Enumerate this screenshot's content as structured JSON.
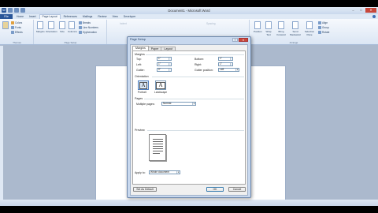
{
  "window": {
    "title": "Document1 - Microsoft Word"
  },
  "tabs": {
    "file": "File",
    "items": [
      "Home",
      "Insert",
      "Page Layout",
      "References",
      "Mailings",
      "Review",
      "View",
      "Developer"
    ],
    "active_index": 2
  },
  "ribbon": {
    "themes": {
      "colors": "Colors",
      "fonts": "Fonts",
      "effects": "Effects",
      "group": "Themes"
    },
    "page_setup": {
      "margins": "Margins",
      "orientation": "Orientation",
      "size": "Size",
      "columns": "Columns",
      "breaks": "Breaks",
      "line_numbers": "Line Numbers",
      "hyphenation": "Hyphenation",
      "group": "Page Setup"
    },
    "paragraph": {
      "indent": "Indent",
      "spacing": "Spacing",
      "group": "Paragraph"
    },
    "arrange": {
      "position": "Position",
      "wrap_text": "Wrap Text",
      "bring_forward": "Bring Forward",
      "send_backward": "Send Backward",
      "selection_pane": "Selection Pane",
      "align": "Align",
      "group_btn": "Group",
      "rotate": "Rotate",
      "group": "Arrange"
    }
  },
  "dialog": {
    "title": "Page Setup",
    "tabs": [
      "Margins",
      "Paper",
      "Layout"
    ],
    "active_tab": 0,
    "margins_label": "Margins",
    "top_label": "Top:",
    "top_value": "1\"",
    "bottom_label": "Bottom:",
    "bottom_value": "1\"",
    "left_label": "Left:",
    "left_value": "1\"",
    "right_label": "Right:",
    "right_value": "1\"",
    "gutter_label": "Gutter:",
    "gutter_value": "0\"",
    "gutter_pos_label": "Gutter position:",
    "gutter_pos_value": "Left",
    "orientation_label": "Orientation",
    "portrait": "Portrait",
    "landscape": "Landscape",
    "pages_label": "Pages",
    "multiple_pages_label": "Multiple pages:",
    "multiple_pages_value": "Normal",
    "preview_label": "Preview",
    "apply_to_label": "Apply to:",
    "apply_to_value": "Whole document",
    "set_default": "Set As Default",
    "ok": "OK",
    "cancel": "Cancel"
  }
}
